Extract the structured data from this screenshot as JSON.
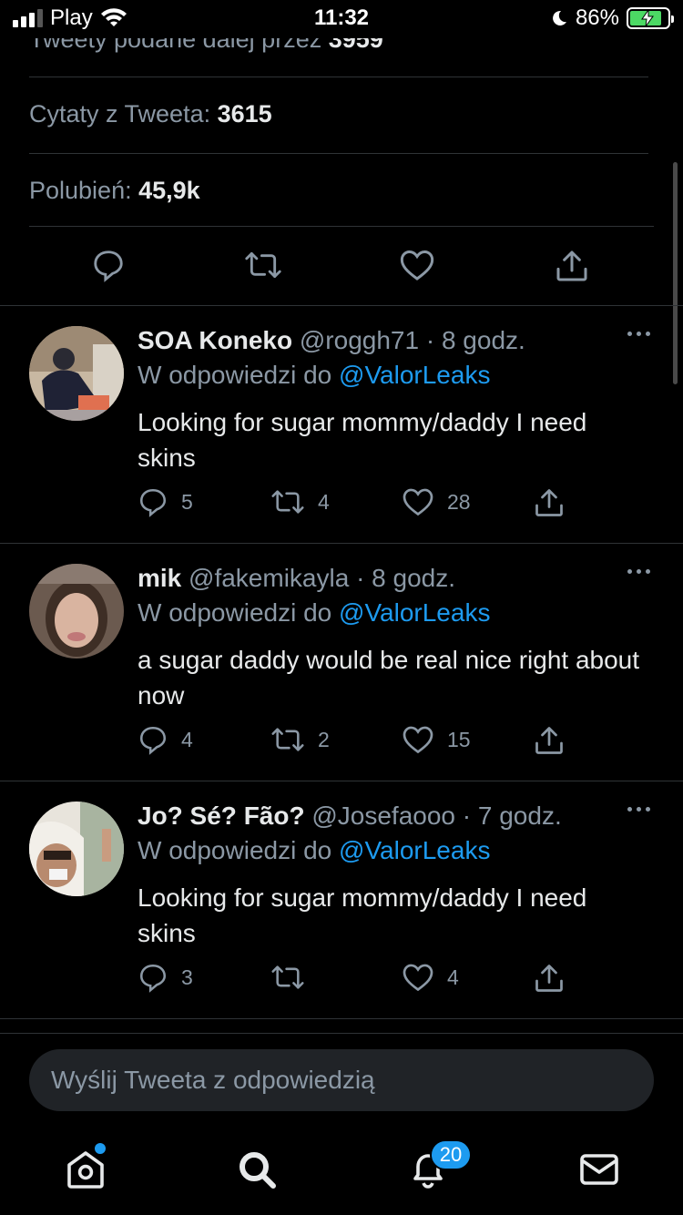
{
  "status_bar": {
    "carrier": "Play",
    "time": "11:32",
    "battery": "86%"
  },
  "tweet_stats": {
    "retweets_label": "Tweety podane dalej przez",
    "retweets_value": "3959",
    "quotes_label": "Cytaty z Tweeta:",
    "quotes_value": "3615",
    "likes_label": "Polubień:",
    "likes_value": "45,9k"
  },
  "replies": [
    {
      "name": "SOA Koneko",
      "handle": "@roggh71",
      "time": "· 8 godz.",
      "reply_to_label": "W odpowiedzi do",
      "reply_to": "@ValorLeaks",
      "text": "Looking for sugar mommy/daddy I need skins",
      "reply_count": "5",
      "retweet_count": "4",
      "like_count": "28"
    },
    {
      "name": "mik",
      "handle": "@fakemikayla",
      "time": "· 8 godz.",
      "reply_to_label": "W odpowiedzi do",
      "reply_to": "@ValorLeaks",
      "text": "a sugar daddy would be real nice right about now",
      "reply_count": "4",
      "retweet_count": "2",
      "like_count": "15"
    },
    {
      "name": "Jo? Sé? Fão?",
      "handle": "@Josefaooo",
      "time": "· 7 godz.",
      "reply_to_label": "W odpowiedzi do",
      "reply_to": "@ValorLeaks",
      "text": "Looking for sugar mommy/daddy I need skins",
      "reply_count": "3",
      "retweet_count": "",
      "like_count": "4"
    }
  ],
  "composer": {
    "placeholder": "Wyślij Tweeta z odpowiedzią"
  },
  "tabbar": {
    "notifications_badge": "20",
    "items": [
      "home-icon",
      "search-icon",
      "bell-icon",
      "mail-icon"
    ]
  },
  "colors": {
    "background": "#000000",
    "accent": "#1d9bf0",
    "muted_text": "#8b98a5",
    "divider": "#2f3336"
  }
}
